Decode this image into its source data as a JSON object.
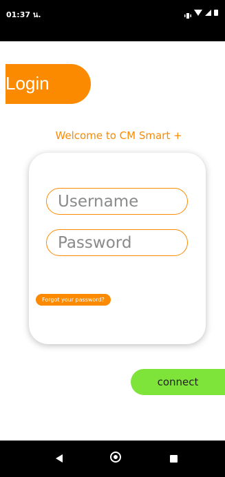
{
  "status_bar": {
    "time": "01:37 น.",
    "icons": [
      "vibrate-icon",
      "wifi-icon",
      "signal-icon",
      "battery-icon"
    ]
  },
  "header": {
    "title": "Login"
  },
  "welcome": "Welcome to CM Smart +",
  "form": {
    "username_placeholder": "Username",
    "password_placeholder": "Password",
    "forgot_label": "Forgot your password?"
  },
  "actions": {
    "connect_label": "connect"
  },
  "nav": {
    "icons": [
      "back-icon",
      "home-icon",
      "recents-icon"
    ]
  },
  "colors": {
    "accent": "#fb8a00",
    "connect": "#7ee43a"
  }
}
